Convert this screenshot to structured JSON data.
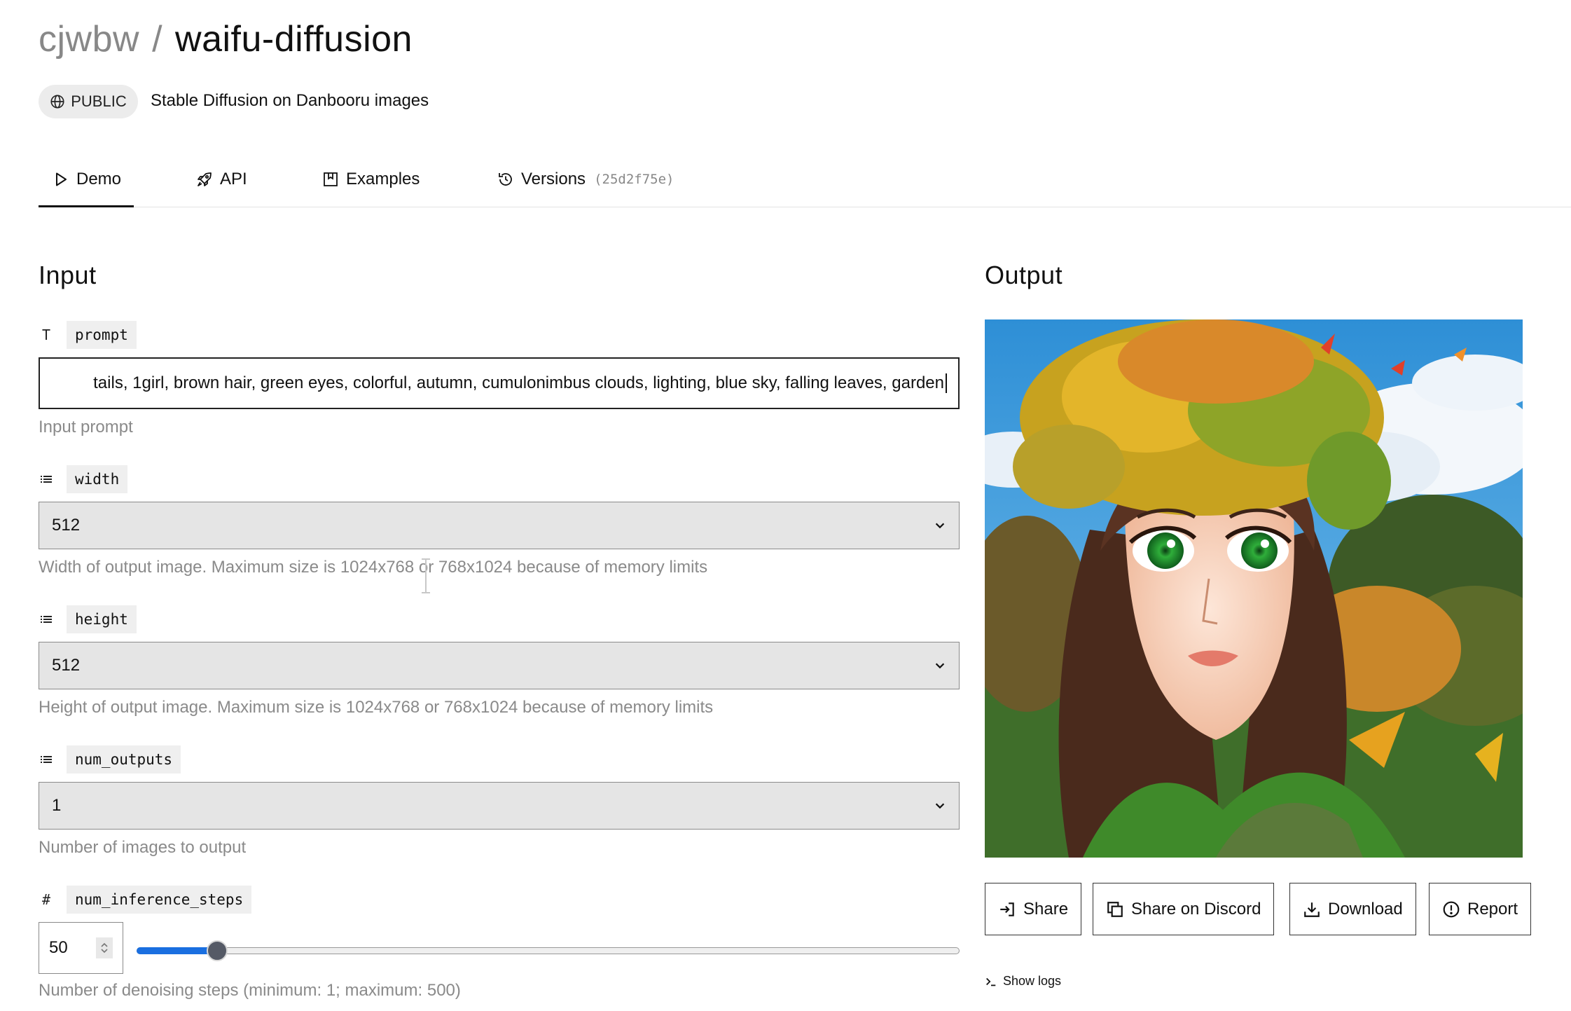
{
  "header": {
    "owner": "cjwbw",
    "separator": "/",
    "model": "waifu-diffusion",
    "visibility": "PUBLIC",
    "description": "Stable Diffusion on Danbooru images"
  },
  "tabs": [
    {
      "label": "Demo",
      "icon": "play-icon",
      "active": true
    },
    {
      "label": "API",
      "icon": "rocket-icon"
    },
    {
      "label": "Examples",
      "icon": "bookmark-icon"
    },
    {
      "label": "Versions",
      "icon": "history-icon",
      "hash": "(25d2f75e)"
    }
  ],
  "input": {
    "title": "Input",
    "prompt": {
      "type_icon": "T",
      "name": "prompt",
      "value": "tails, 1girl, brown hair, green eyes, colorful, autumn, cumulonimbus clouds, lighting, blue sky, falling leaves, garden",
      "help": "Input prompt"
    },
    "width": {
      "type_icon": "list-icon",
      "name": "width",
      "value": "512",
      "help": "Width of output image. Maximum size is 1024x768 or 768x1024 because of memory limits"
    },
    "height": {
      "type_icon": "list-icon",
      "name": "height",
      "value": "512",
      "help": "Height of output image. Maximum size is 1024x768 or 768x1024 because of memory limits"
    },
    "num_outputs": {
      "type_icon": "list-icon",
      "name": "num_outputs",
      "value": "1",
      "help": "Number of images to output"
    },
    "num_inference_steps": {
      "type_icon": "#",
      "name": "num_inference_steps",
      "value": "50",
      "slider_fraction": 0.098,
      "help": "Number of denoising steps (minimum: 1; maximum: 500)"
    }
  },
  "output": {
    "title": "Output",
    "buttons": {
      "share": "Share",
      "discord": "Share on Discord",
      "download": "Download",
      "report": "Report"
    },
    "show_logs": "Show logs"
  },
  "colors": {
    "accent": "#1a6fe0",
    "muted_text": "#8a8a8a"
  }
}
